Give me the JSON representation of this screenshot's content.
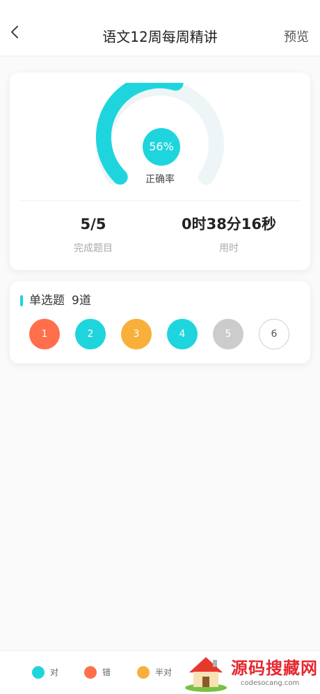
{
  "nav": {
    "title": "语文12周每周精讲",
    "preview_label": "预览"
  },
  "score": {
    "accuracy_percent": 56,
    "accuracy_text": "56%",
    "accuracy_label": "正确率",
    "completed_value": "5/5",
    "completed_label": "完成题目",
    "time_value": "0时38分16秒",
    "time_label": "用时"
  },
  "section": {
    "title": "单选题",
    "count": "9道",
    "questions": [
      {
        "number": "1",
        "status": "wrong"
      },
      {
        "number": "2",
        "status": "correct"
      },
      {
        "number": "3",
        "status": "half"
      },
      {
        "number": "4",
        "status": "correct"
      },
      {
        "number": "5",
        "status": "ungraded"
      },
      {
        "number": "6",
        "status": "unanswered"
      }
    ]
  },
  "legend": [
    {
      "label": "对",
      "color": "#1fd5dd"
    },
    {
      "label": "错",
      "color": "#ff6f4c"
    },
    {
      "label": "半对",
      "color": "#f8b03a"
    }
  ],
  "colors": {
    "correct": "#1fd5dd",
    "wrong": "#ff6f4c",
    "half": "#f8b03a",
    "ungraded": "#cccccc",
    "track": "#eef5f6"
  },
  "watermark": {
    "title": "源码搜藏网",
    "url": "codesocang.com"
  }
}
